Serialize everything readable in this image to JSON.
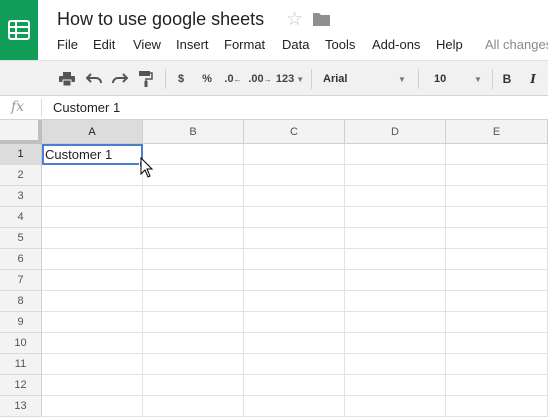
{
  "app": {
    "title": "How to use google sheets",
    "logo_icon": "sheets-logo-icon",
    "brand_color": "#0f9d58"
  },
  "menu": {
    "items": [
      "File",
      "Edit",
      "View",
      "Insert",
      "Format",
      "Data",
      "Tools",
      "Add-ons",
      "Help"
    ],
    "status": "All changes"
  },
  "toolbar": {
    "currency_label": "$",
    "percent_label": "%",
    "decrease_decimal_label": ".0",
    "increase_decimal_label": ".00",
    "more_formats_label": "123",
    "font_family": "Arial",
    "font_size": "10",
    "bold_label": "B",
    "italic_label": "I"
  },
  "formula_bar": {
    "fx_label": "fx",
    "value": "Customer 1"
  },
  "sheet": {
    "columns": [
      "A",
      "B",
      "C",
      "D",
      "E"
    ],
    "rows": [
      "1",
      "2",
      "3",
      "4",
      "5",
      "6",
      "7",
      "8",
      "9",
      "10",
      "11",
      "12",
      "13"
    ],
    "selected_cell": "A1",
    "cells": {
      "A1": "Customer 1"
    },
    "selection_color": "#4a7ed3"
  }
}
